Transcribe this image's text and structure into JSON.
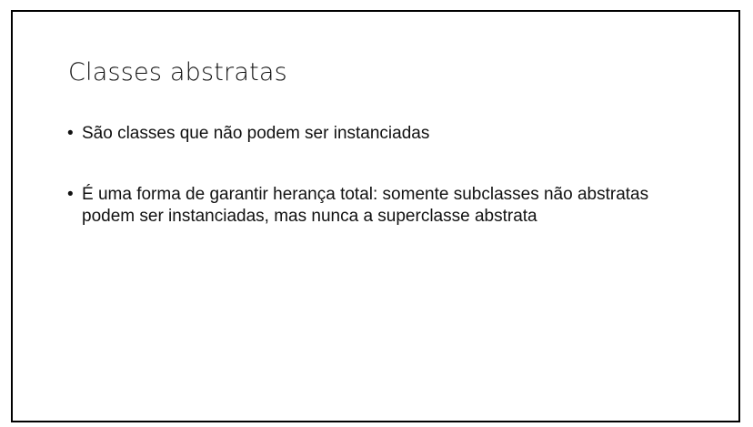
{
  "slide": {
    "title": "Classes abstratas",
    "bullets": [
      {
        "text": "São classes que não podem ser instanciadas"
      },
      {
        "text": "É uma forma de garantir herança total: somente subclasses não abstratas podem ser instanciadas, mas nunca a superclasse abstrata"
      }
    ]
  }
}
